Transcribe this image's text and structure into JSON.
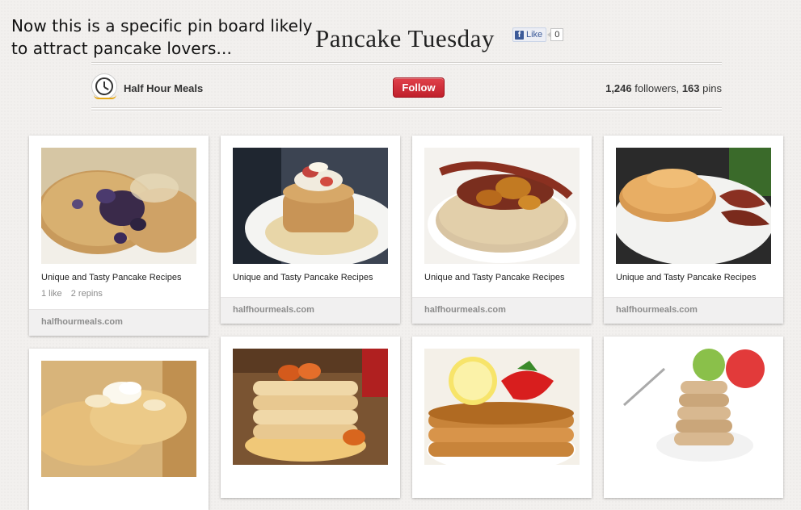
{
  "annotation": {
    "line1": "Now this is a specific pin board likely",
    "line2": "to attract pancake lovers..."
  },
  "board": {
    "title": "Pancake Tuesday",
    "fb_like_label": "Like",
    "fb_like_count": "0",
    "owner_name": "Half Hour Meals",
    "follow_label": "Follow",
    "followers_count": "1,246",
    "followers_label": "followers,",
    "pins_count": "163",
    "pins_label": "pins"
  },
  "pins": [
    {
      "description": "Unique and Tasty Pancake Recipes",
      "likes": "1 like",
      "repins": "2 repins",
      "source": "halfhourmeals.com"
    },
    {
      "description": "Unique and Tasty Pancake Recipes",
      "source": "halfhourmeals.com"
    },
    {
      "description": "Unique and Tasty Pancake Recipes",
      "source": "halfhourmeals.com"
    },
    {
      "description": "Unique and Tasty Pancake Recipes",
      "source": "halfhourmeals.com"
    }
  ],
  "colors": {
    "follow_button": "#cb2027",
    "facebook_blue": "#3b5998"
  },
  "icons": {
    "fb": "facebook-logo-icon",
    "avatar": "clock-logo-icon"
  }
}
